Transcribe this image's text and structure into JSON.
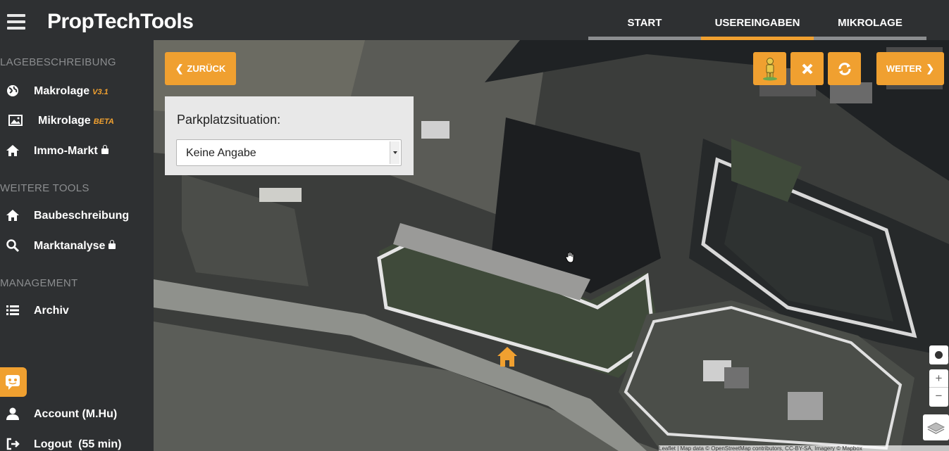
{
  "app": {
    "title": "PropTechTools",
    "accent_color": "#f0a030",
    "sidebar_bg": "#2e3032"
  },
  "header": {
    "tabs": [
      {
        "label": "START",
        "active": false
      },
      {
        "label": "USEREINGABEN",
        "active": true
      },
      {
        "label": "MIKROLAGE",
        "active": false
      }
    ]
  },
  "sidebar": {
    "section_lage": "LAGEBESCHREIBUNG",
    "section_tools": "WEITERE TOOLS",
    "section_management": "MANAGEMENT",
    "items": {
      "makrolage": {
        "label": "Makrolage",
        "badge": "V3.1",
        "icon": "globe-icon"
      },
      "mikrolage": {
        "label": "Mikrolage",
        "badge": "BETA",
        "icon": "image-icon"
      },
      "immomarkt": {
        "label": "Immo-Markt",
        "locked": true,
        "icon": "home-icon"
      },
      "baubeschreibung": {
        "label": "Baubeschreibung",
        "icon": "home-icon"
      },
      "marktanalyse": {
        "label": "Marktanalyse",
        "locked": true,
        "icon": "search-icon"
      },
      "archiv": {
        "label": "Archiv",
        "icon": "list-icon"
      },
      "account": {
        "label": "Account (M.Hu)",
        "icon": "user-icon"
      },
      "logout": {
        "label": "Logout  (55 min)",
        "icon": "logout-icon"
      }
    }
  },
  "map": {
    "back_label": "ZURÜCK",
    "next_label": "WEITER",
    "panel_label": "Parkplatzsituation:",
    "select_value": "Keine Angabe",
    "zoom_in": "+",
    "zoom_out": "−",
    "attribution": "Leaflet | Map data © OpenStreetMap contributors, CC-BY-SA, Imagery © Mapbox"
  }
}
